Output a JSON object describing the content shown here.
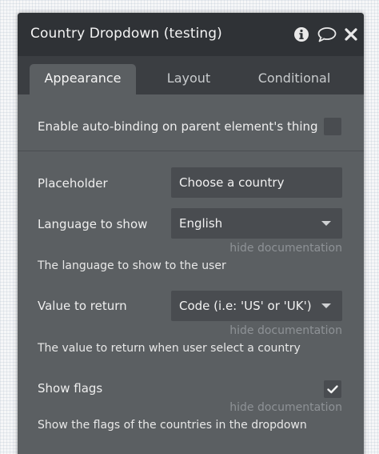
{
  "window": {
    "title": "Country Dropdown (testing)",
    "icons": [
      "info-icon",
      "comment-icon",
      "close-icon"
    ]
  },
  "tabs": [
    {
      "label": "Appearance",
      "active": true
    },
    {
      "label": "Layout",
      "active": false
    },
    {
      "label": "Conditional",
      "active": false
    }
  ],
  "autobinding": {
    "label": "Enable auto-binding on parent element's thing",
    "checked": false
  },
  "placeholder": {
    "label": "Placeholder",
    "value": "Choose a country"
  },
  "language": {
    "label": "Language to show",
    "value": "English",
    "doc_link": "hide documentation",
    "description": "The language to show to the user"
  },
  "value_to_return": {
    "label": "Value to return",
    "value": "Code (i.e: 'US' or 'UK')",
    "doc_link": "hide documentation",
    "description": "The value to return when user select a country"
  },
  "show_flags": {
    "label": "Show flags",
    "checked": true,
    "doc_link": "hide documentation",
    "description": "Show the flags of the countries in the dropdown"
  },
  "colors": {
    "panel_bg": "#5b5f62",
    "titlebar_bg": "#2f3236",
    "tabbar_bg": "#3b3e42",
    "input_bg": "#494c50",
    "muted_text": "#8e9296"
  }
}
